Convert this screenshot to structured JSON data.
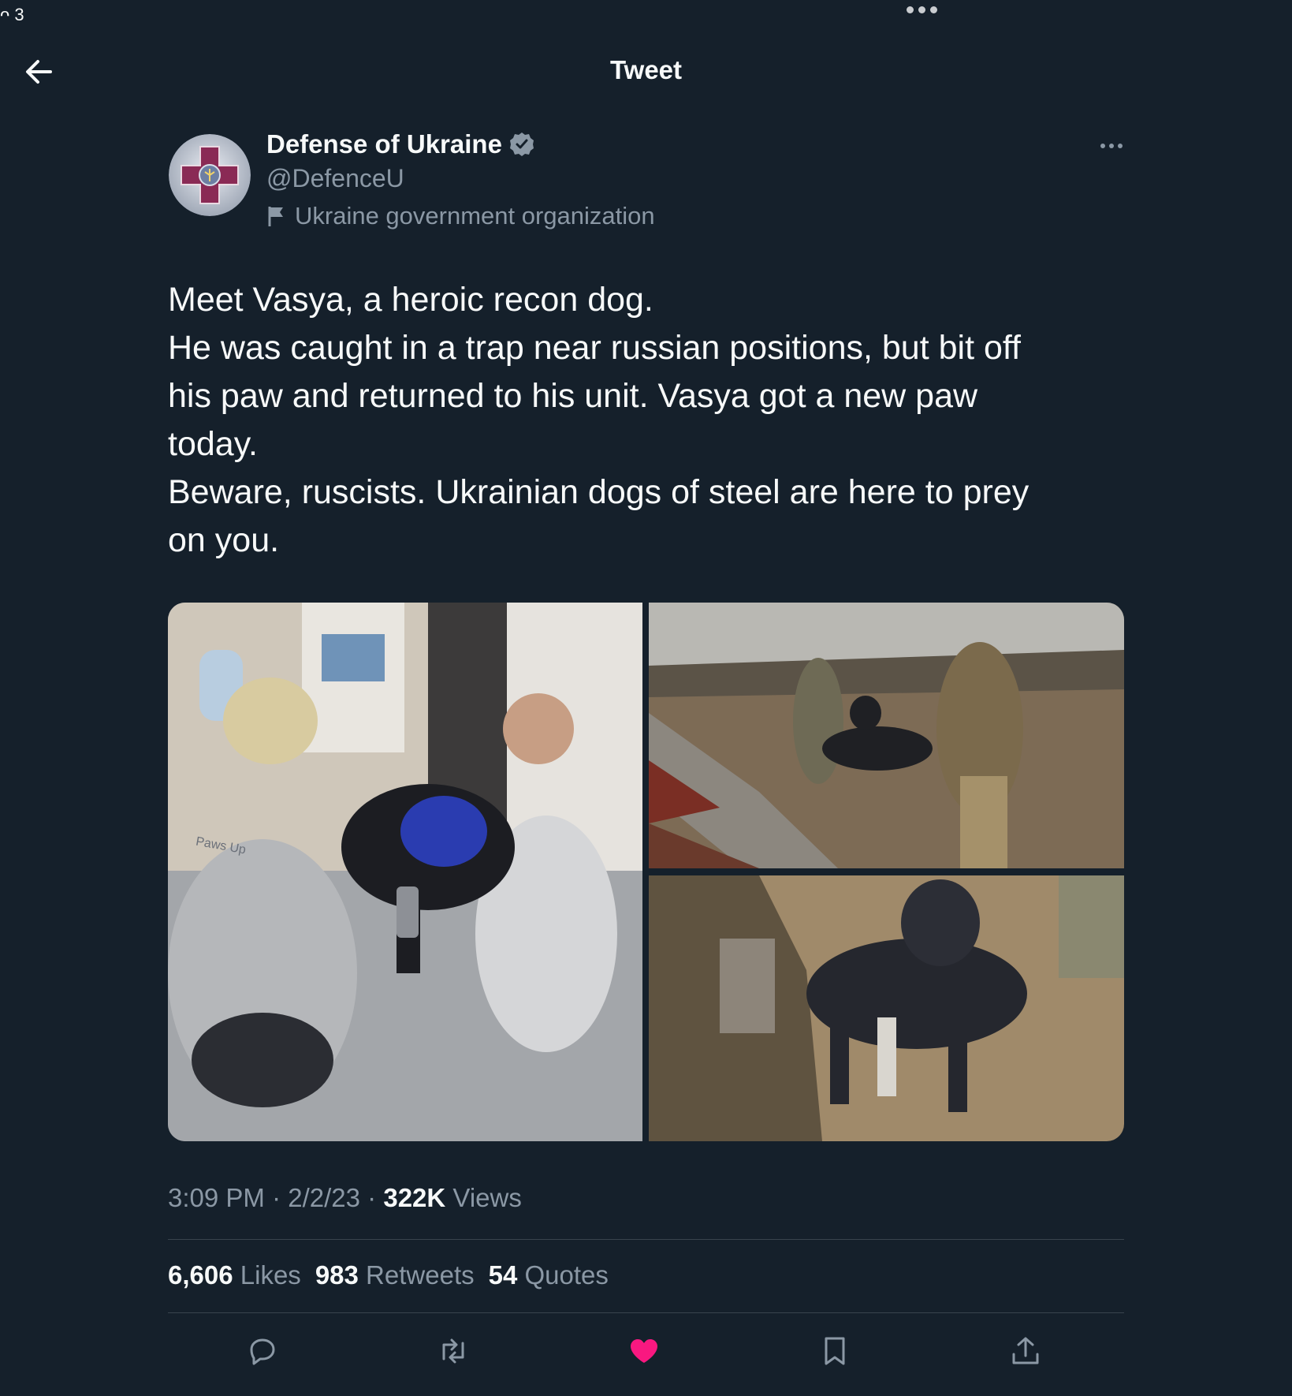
{
  "status": {
    "left_text": "ᴖ 3"
  },
  "header": {
    "title": "Tweet"
  },
  "author": {
    "name": "Defense of Ukraine",
    "handle": "@DefenceU",
    "label": "Ukraine government organization"
  },
  "tweet": {
    "lines": [
      "Meet Vasya, a heroic recon dog.",
      "He was caught in a trap near russian positions, but bit off",
      "his paw and returned to his unit. Vasya got a new paw",
      "today.",
      "Beware, ruscists. Ukrainian dogs of steel are here to prey",
      "on you."
    ],
    "time": "3:09 PM",
    "date": "2/2/23",
    "views_count": "322K",
    "views_label": "Views"
  },
  "media": {
    "photos": [
      "veterinary-clinic-prosthetic-fitting-photo",
      "soldiers-carrying-dog-photo",
      "dog-in-trench-photo"
    ],
    "watermark": "Paws Up"
  },
  "stats": {
    "likes_count": "6,606",
    "likes_label": "Likes",
    "retweets_count": "983",
    "retweets_label": "Retweets",
    "quotes_count": "54",
    "quotes_label": "Quotes"
  },
  "actions": [
    "reply-icon",
    "retweet-icon",
    "like-icon",
    "bookmark-icon",
    "share-icon"
  ],
  "colors": {
    "background": "#15202b",
    "text": "#f7f9f9",
    "secondary": "#8b98a5",
    "like": "#f91880",
    "verified": "#8b98a5"
  }
}
